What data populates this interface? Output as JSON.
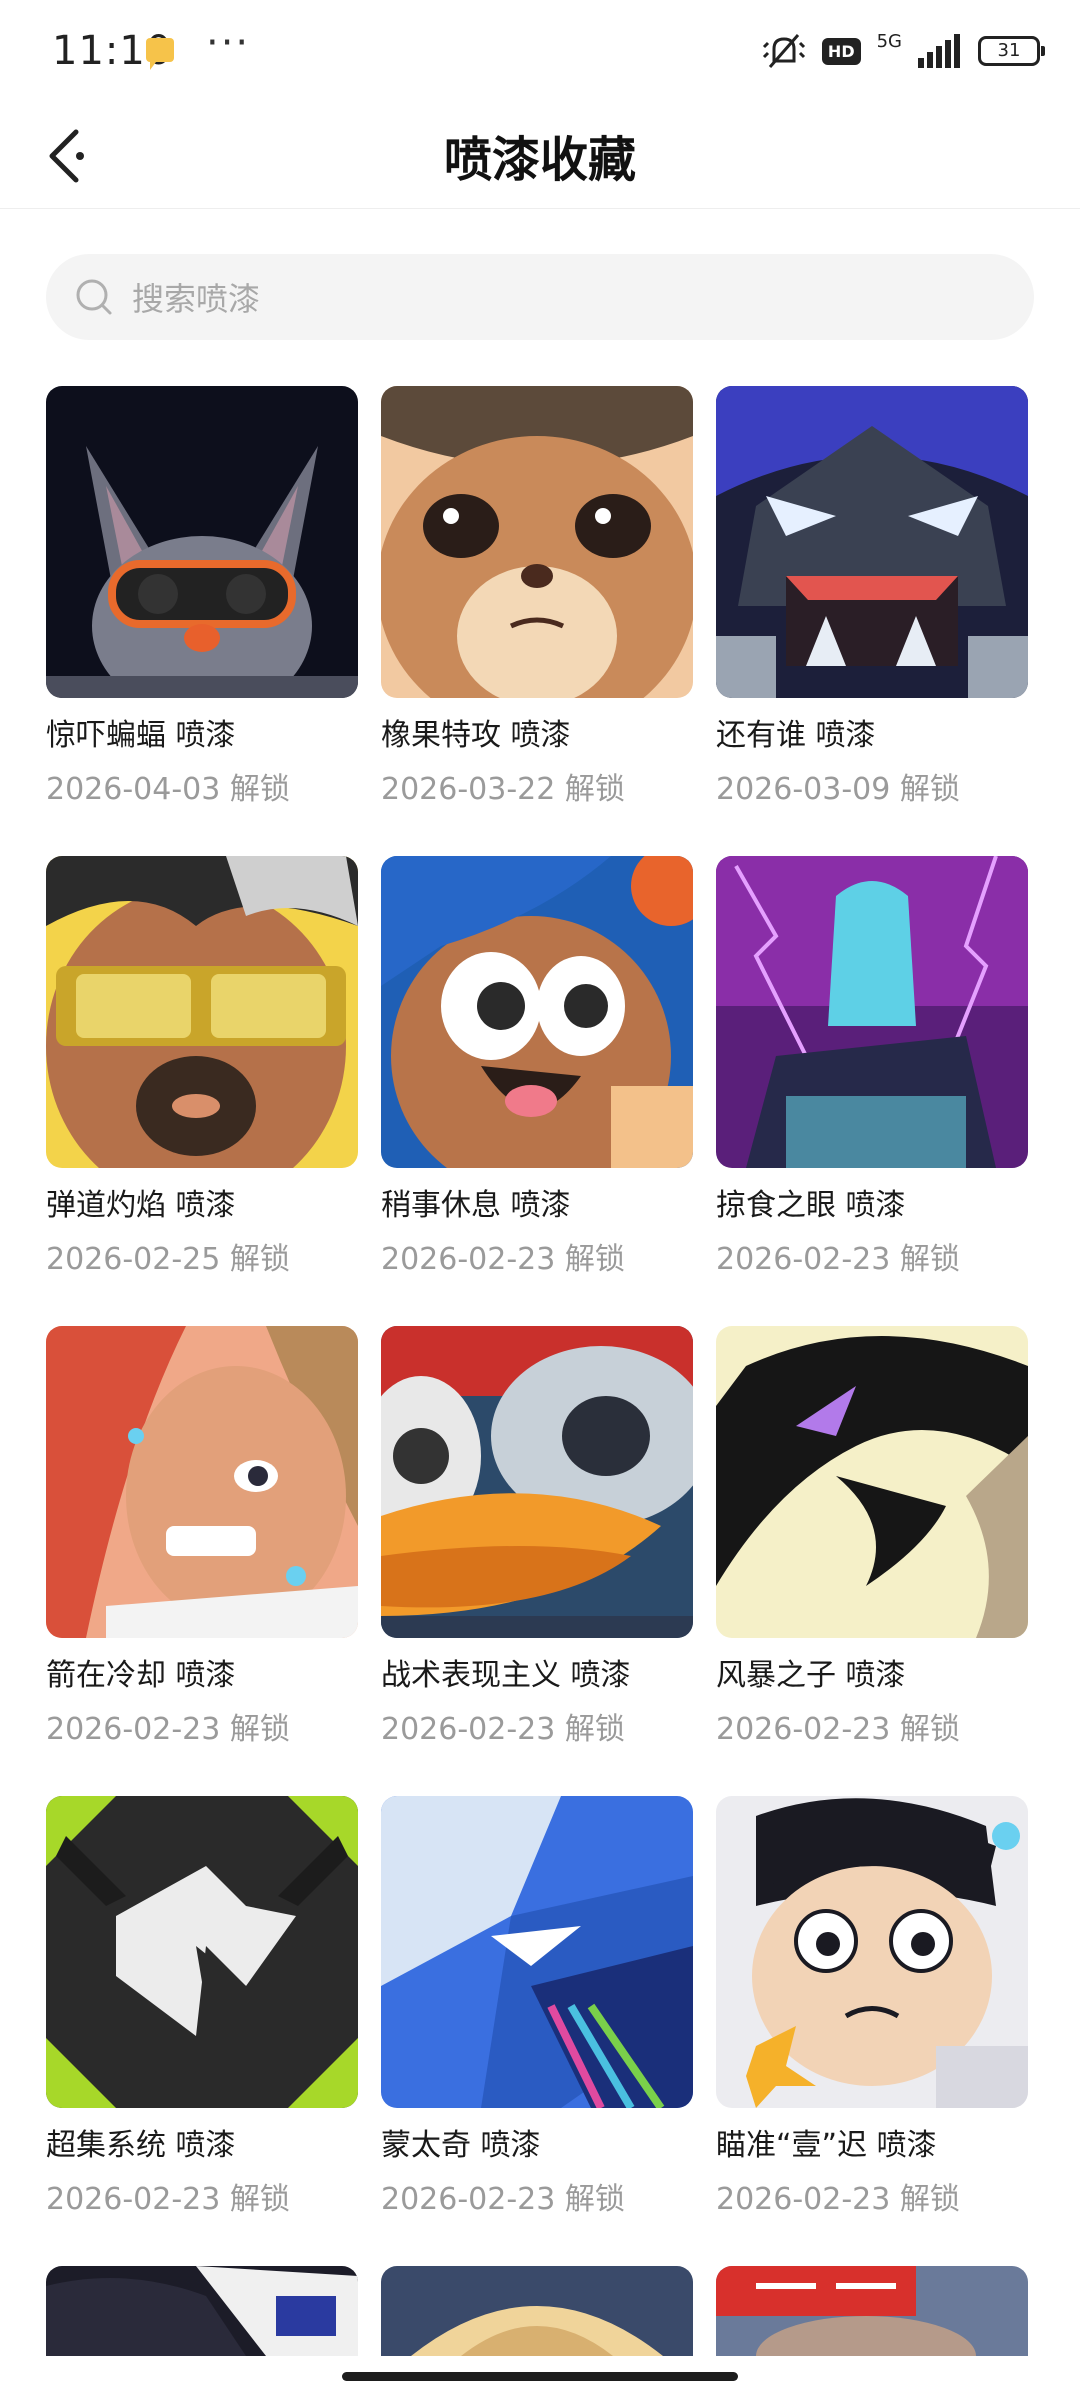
{
  "status_bar": {
    "time": "11:10",
    "hd": "HD",
    "network": "5G",
    "battery": "31"
  },
  "header": {
    "title": "喷漆收藏"
  },
  "search": {
    "placeholder": "搜索喷漆"
  },
  "items": [
    {
      "name": "惊吓蝙蝠 喷漆",
      "date": "2026-04-03 解锁"
    },
    {
      "name": "橡果特攻 喷漆",
      "date": "2026-03-22 解锁"
    },
    {
      "name": "还有谁 喷漆",
      "date": "2026-03-09 解锁"
    },
    {
      "name": "弹道灼焰 喷漆",
      "date": "2026-02-25 解锁"
    },
    {
      "name": "稍事休息 喷漆",
      "date": "2026-02-23 解锁"
    },
    {
      "name": "掠食之眼 喷漆",
      "date": "2026-02-23 解锁"
    },
    {
      "name": "箭在冷却 喷漆",
      "date": "2026-02-23 解锁"
    },
    {
      "name": "战术表现主义 喷漆",
      "date": "2026-02-23 解锁"
    },
    {
      "name": "风暴之子 喷漆",
      "date": "2026-02-23 解锁"
    },
    {
      "name": "超集系统 喷漆",
      "date": "2026-02-23 解锁"
    },
    {
      "name": "蒙太奇 喷漆",
      "date": "2026-02-23 解锁"
    },
    {
      "name": "瞄准“壹”迟 喷漆",
      "date": "2026-02-23 解锁"
    }
  ]
}
